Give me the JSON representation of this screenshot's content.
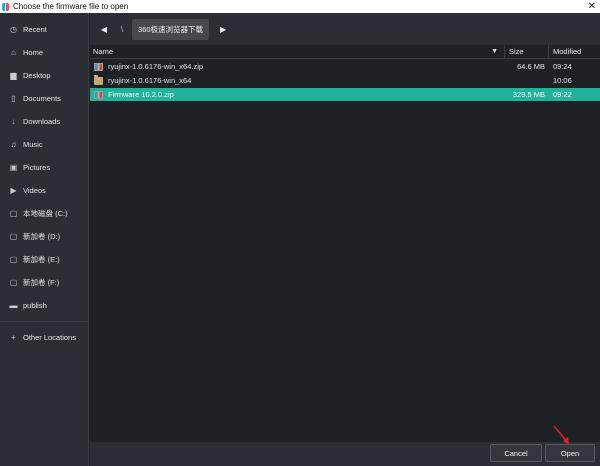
{
  "window": {
    "title": "Choose the firmware file to open",
    "close_glyph": "✕"
  },
  "sidebar": {
    "items": [
      {
        "label": "Recent",
        "icon": "clock-icon",
        "glyph": "◷"
      },
      {
        "label": "Home",
        "icon": "home-icon",
        "glyph": "⌂"
      },
      {
        "label": "Desktop",
        "icon": "desktop-folder-icon",
        "glyph": "▆"
      },
      {
        "label": "Documents",
        "icon": "document-icon",
        "glyph": "▯"
      },
      {
        "label": "Downloads",
        "icon": "download-icon",
        "glyph": "↓"
      },
      {
        "label": "Music",
        "icon": "music-icon",
        "glyph": "♫"
      },
      {
        "label": "Pictures",
        "icon": "picture-icon",
        "glyph": "▣"
      },
      {
        "label": "Videos",
        "icon": "video-icon",
        "glyph": "▶"
      },
      {
        "label": "本地磁盘 (C:)",
        "icon": "drive-icon",
        "glyph": "▢"
      },
      {
        "label": "新加卷 (D:)",
        "icon": "drive-icon",
        "glyph": "▢"
      },
      {
        "label": "新加卷 (E:)",
        "icon": "drive-icon",
        "glyph": "▢"
      },
      {
        "label": "新加卷 (F:)",
        "icon": "drive-icon",
        "glyph": "▢"
      },
      {
        "label": "publish",
        "icon": "folder-icon",
        "glyph": "▬"
      }
    ],
    "other": {
      "label": "Other Locations",
      "glyph": "+"
    }
  },
  "pathbar": {
    "back_glyph": "◀",
    "root": "\\",
    "current": "360极速浏览器下载",
    "forward_glyph": "▶"
  },
  "columns": {
    "name": "Name",
    "size": "Size",
    "modified": "Modified",
    "sort_glyph": "▼"
  },
  "files": [
    {
      "name": "ryujinx-1.0.6176-win_x64.zip",
      "size": "64.6 MB",
      "modified": "09:24",
      "type": "zip"
    },
    {
      "name": "ryujinx-1.0.6176-win_x64",
      "size": "",
      "modified": "10:06",
      "type": "folder"
    },
    {
      "name": "Firmware 10.2.0.zip",
      "size": "329.5 MB",
      "modified": "09:22",
      "type": "zip",
      "selected": true
    }
  ],
  "buttons": {
    "cancel": "Cancel",
    "open": "Open"
  },
  "colors": {
    "selection": "#1fb49a",
    "annotation_arrow": "#e02020"
  }
}
